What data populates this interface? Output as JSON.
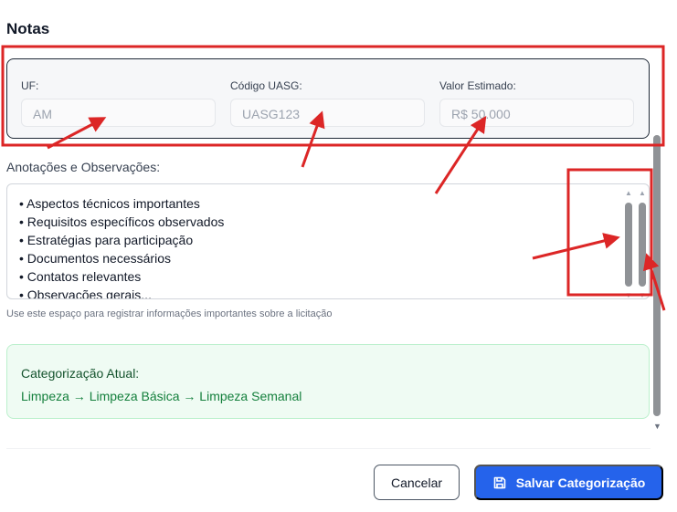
{
  "section": {
    "title": "Notas"
  },
  "info": {
    "uf_label": "UF:",
    "uf_value": "AM",
    "uasg_label": "Código UASG:",
    "uasg_value": "UASG123",
    "valor_label": "Valor Estimado:",
    "valor_value": "R$ 50.000"
  },
  "notes": {
    "label": "Anotações e Observações:",
    "lines": [
      "• Aspectos técnicos importantes",
      "• Requisitos específicos observados",
      "• Estratégias para participação",
      "• Documentos necessários",
      "• Contatos relevantes",
      "• Observações gerais..."
    ],
    "help": "Use este espaço para registrar informações importantes sobre a licitação"
  },
  "categorization": {
    "title": "Categorização Atual:",
    "path": "Limpeza → Limpeza Básica → Limpeza Semanal"
  },
  "footer": {
    "cancel_label": "Cancelar",
    "save_label": "Salvar Categorização",
    "save_icon": "save-icon"
  },
  "colors": {
    "primary": "#2563eb",
    "annotation_red": "#dc2626",
    "success_bg": "#effbf3",
    "success_text": "#15803d"
  }
}
